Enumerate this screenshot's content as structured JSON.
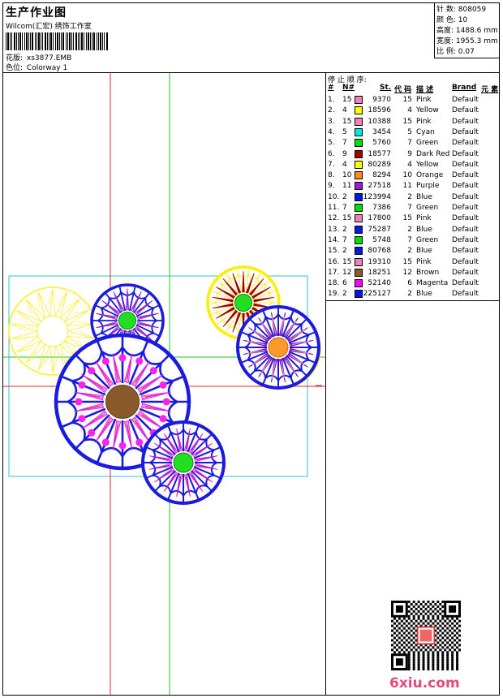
{
  "header": {
    "title": "生产作业图",
    "subtitle": "Wilcom(汇宏) 绣饰工作室",
    "design_label": "花版:",
    "design_value": "xs3877.EMB",
    "colorway_label": "色位:",
    "colorway_value": "Colorway 1"
  },
  "stats": [
    {
      "label": "针 数:",
      "value": "808059"
    },
    {
      "label": "颜 色:",
      "value": "10"
    },
    {
      "label": "高度:",
      "value": "1488.6 mm"
    },
    {
      "label": "宽度:",
      "value": "1955.3 mm"
    },
    {
      "label": "比 例:",
      "value": "0.07"
    }
  ],
  "stop_sequence": {
    "title": "停 止 顺 序:",
    "headers": {
      "num": "#",
      "n": "N#",
      "st": "St.",
      "code": "代 码",
      "desc": "描 述",
      "brand": "Brand",
      "elem": "元 素"
    },
    "rows": [
      {
        "num": "1.",
        "n": "15",
        "color": "#f27fb8",
        "st": "9370",
        "code": "15",
        "desc": "Pink",
        "brand": "Default"
      },
      {
        "num": "2.",
        "n": "4",
        "color": "#ffff00",
        "st": "18596",
        "code": "4",
        "desc": "Yellow",
        "brand": "Default"
      },
      {
        "num": "3.",
        "n": "15",
        "color": "#f27fb8",
        "st": "10388",
        "code": "15",
        "desc": "Pink",
        "brand": "Default"
      },
      {
        "num": "4.",
        "n": "5",
        "color": "#00e5e5",
        "st": "3454",
        "code": "5",
        "desc": "Cyan",
        "brand": "Default"
      },
      {
        "num": "5.",
        "n": "7",
        "color": "#00dd00",
        "st": "5760",
        "code": "7",
        "desc": "Green",
        "brand": "Default"
      },
      {
        "num": "6.",
        "n": "9",
        "color": "#a00000",
        "st": "18577",
        "code": "9",
        "desc": "Dark Red",
        "brand": "Default"
      },
      {
        "num": "7.",
        "n": "4",
        "color": "#ffff00",
        "st": "80289",
        "code": "4",
        "desc": "Yellow",
        "brand": "Default"
      },
      {
        "num": "8.",
        "n": "10",
        "color": "#ff8c1a",
        "st": "8294",
        "code": "10",
        "desc": "Orange",
        "brand": "Default"
      },
      {
        "num": "9.",
        "n": "11",
        "color": "#9b1bd6",
        "st": "27518",
        "code": "11",
        "desc": "Purple",
        "brand": "Default"
      },
      {
        "num": "10.",
        "n": "2",
        "color": "#0018e0",
        "st": "123994",
        "code": "2",
        "desc": "Blue",
        "brand": "Default"
      },
      {
        "num": "11.",
        "n": "7",
        "color": "#00dd00",
        "st": "7386",
        "code": "7",
        "desc": "Green",
        "brand": "Default"
      },
      {
        "num": "12.",
        "n": "15",
        "color": "#f27fb8",
        "st": "17800",
        "code": "15",
        "desc": "Pink",
        "brand": "Default"
      },
      {
        "num": "13.",
        "n": "2",
        "color": "#0018e0",
        "st": "75287",
        "code": "2",
        "desc": "Blue",
        "brand": "Default"
      },
      {
        "num": "14.",
        "n": "7",
        "color": "#00dd00",
        "st": "5748",
        "code": "7",
        "desc": "Green",
        "brand": "Default"
      },
      {
        "num": "15.",
        "n": "2",
        "color": "#0018e0",
        "st": "80768",
        "code": "2",
        "desc": "Blue",
        "brand": "Default"
      },
      {
        "num": "16.",
        "n": "15",
        "color": "#f27fb8",
        "st": "19310",
        "code": "15",
        "desc": "Pink",
        "brand": "Default"
      },
      {
        "num": "17.",
        "n": "12",
        "color": "#8b5a2b",
        "st": "18251",
        "code": "12",
        "desc": "Brown",
        "brand": "Default"
      },
      {
        "num": "18.",
        "n": "6",
        "color": "#ff00ff",
        "st": "52140",
        "code": "6",
        "desc": "Magenta",
        "brand": "Default"
      },
      {
        "num": "19.",
        "n": "2",
        "color": "#0018e0",
        "st": "225127",
        "code": "2",
        "desc": "Blue",
        "brand": "Default"
      }
    ]
  },
  "watermark": "6xiu.com"
}
